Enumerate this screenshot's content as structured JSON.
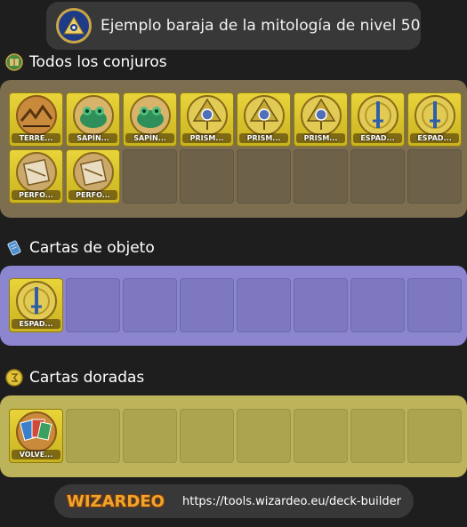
{
  "header": {
    "title": "Ejemplo baraja de la mitología de nivel 50",
    "icon": "mythology-school-icon"
  },
  "sections": {
    "spells": {
      "title": "Todos los conjuros",
      "icon": "spellbook-icon",
      "color": "#7e6e50",
      "cards": [
        {
          "label": "TERRE...",
          "icon": "earthquake-icon"
        },
        {
          "label": "SAPÍN...",
          "icon": "frog-icon"
        },
        {
          "label": "SAPÍN...",
          "icon": "frog-icon"
        },
        {
          "label": "PRISM...",
          "icon": "prism-icon"
        },
        {
          "label": "PRISM...",
          "icon": "prism-icon"
        },
        {
          "label": "PRISM...",
          "icon": "prism-icon"
        },
        {
          "label": "ESPAD...",
          "icon": "sword-icon"
        },
        {
          "label": "ESPAD...",
          "icon": "sword-icon"
        },
        {
          "label": "PERFO...",
          "icon": "pierce-icon"
        },
        {
          "label": "PERFO...",
          "icon": "pierce-icon"
        }
      ],
      "total_slots": 16
    },
    "items": {
      "title": "Cartas de objeto",
      "icon": "item-card-icon",
      "color": "#8b86cf",
      "cards": [
        {
          "label": "ESPAD...",
          "icon": "sword-icon"
        }
      ],
      "total_slots": 8
    },
    "gold": {
      "title": "Cartas doradas",
      "icon": "gold-coin-icon",
      "color": "#bdb35b",
      "cards": [
        {
          "label": "VOLVE...",
          "icon": "reshuffle-icon"
        }
      ],
      "total_slots": 8
    }
  },
  "footer": {
    "logo_text": "WIZARDEO",
    "url": "https://tools.wizardeo.eu/deck-builder"
  }
}
